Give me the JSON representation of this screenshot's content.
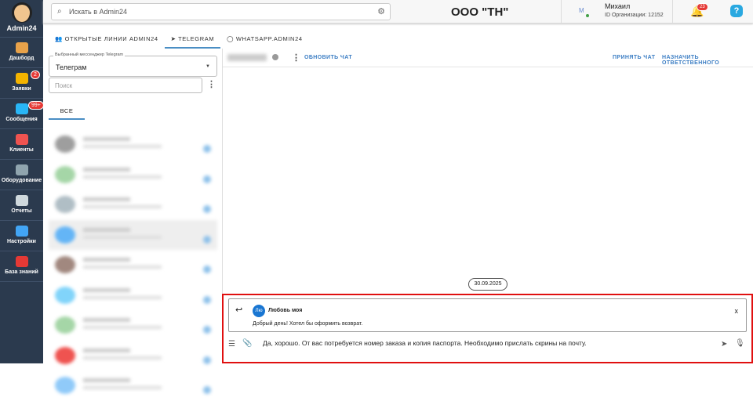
{
  "sidebar": {
    "brand": "Admin24",
    "items": [
      {
        "label": "Дашборд",
        "icon": "dashboard-icon",
        "color": "#e8a24a"
      },
      {
        "label": "Заявки",
        "icon": "megaphone-icon",
        "color": "#f4b400",
        "badge": "2"
      },
      {
        "label": "Сообщения",
        "icon": "chat-bubbles-icon",
        "color": "#29b6f6",
        "badge": "99+"
      },
      {
        "label": "Клиенты",
        "icon": "clients-icon",
        "color": "#ef5350"
      },
      {
        "label": "Оборудование",
        "icon": "equipment-icon",
        "color": "#90a4ae"
      },
      {
        "label": "Отчеты",
        "icon": "report-icon",
        "color": "#cfd8dc"
      },
      {
        "label": "Настройки",
        "icon": "gear-icon",
        "color": "#42a5f5"
      },
      {
        "label": "База знаний",
        "icon": "knowledge-base-icon",
        "color": "#e53935"
      }
    ]
  },
  "topbar": {
    "search_placeholder": "Искать в Admin24",
    "company": "ООО \"ТН\"",
    "user_initial": "M",
    "user_name": "Михаил",
    "org_id": "ID Организации: 12152",
    "notifications": "23",
    "help": "?"
  },
  "tabs": [
    {
      "label": "ОТКРЫТЫЕ ЛИНИИ ADMIN24"
    },
    {
      "label": "TELEGRAM",
      "active": true
    },
    {
      "label": "WHATSAPP.ADMIN24"
    }
  ],
  "left": {
    "messenger_label": "Выбранный мессенджер Telegram",
    "messenger_value": "Телеграм",
    "search_placeholder": "Поиск",
    "filter_tab": "ВСЕ"
  },
  "chat": {
    "refresh": "ОБНОВИТЬ ЧАТ",
    "accept": "ПРИНЯТЬ ЧАТ",
    "assign": "НАЗНАЧИТЬ ОТВЕТСТВЕННОГО",
    "date": "30.09.2025",
    "reply": {
      "initials": "Лю",
      "name": "Любовь моя",
      "text": "Добрый день! Хотел бы оформить возврат.",
      "close": "x"
    },
    "message": "Да, хорошо. От вас потребуется номер заказа и копия паспорта. Необходимо прислать скрины на почту."
  }
}
